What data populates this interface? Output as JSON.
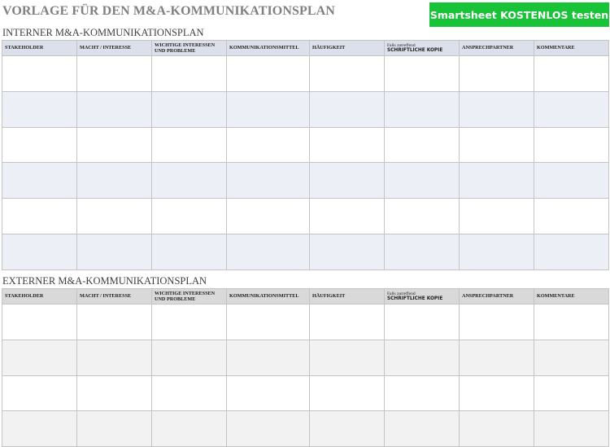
{
  "header": {
    "title": "VORLAGE FÜR DEN M&A-KOMMUNIKATIONSPLAN",
    "cta_label": "Smartsheet KOSTENLOS testen",
    "cta_color": "#19c337"
  },
  "columns": {
    "stakeholder": "STAKEHOLDER",
    "power": "MACHT / INTERESSE",
    "interests": "WICHTIGE INTERESSEN UND PROBLEME",
    "channel": "KOMMUNIKATIONSMITTEL",
    "frequency": "HÄUFIGKEIT",
    "copy_note": "Falls zutreffend",
    "copy": "SCHRIFTLICHE KOPIE",
    "contact": "ANSPRECHPARTNER",
    "comments": "KOMMENTARE"
  },
  "internal": {
    "title": "INTERNER M&A-KOMMUNIKATIONSPLAN",
    "header_color": "#dbe0ea"
  },
  "external": {
    "title": "EXTERNER M&A-KOMMUNIKATIONSPLAN",
    "header_color": "#d9d9d9"
  }
}
